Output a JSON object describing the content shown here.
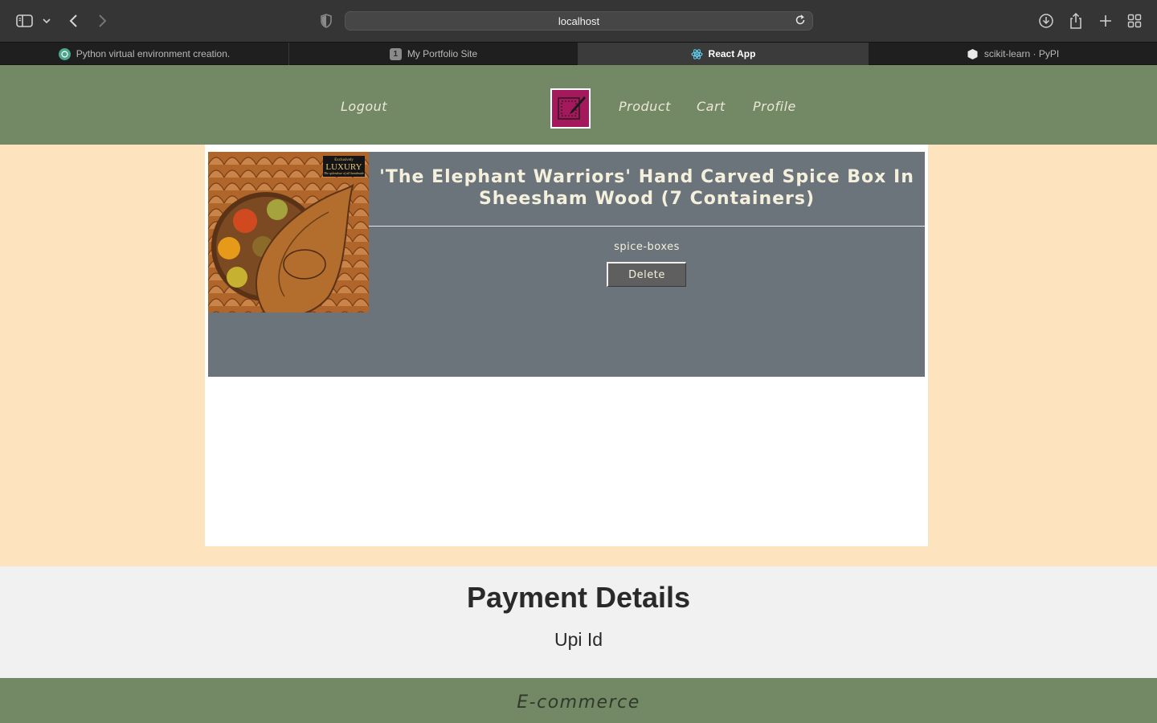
{
  "browser": {
    "url": "localhost",
    "tabs": [
      {
        "label": "Python virtual environment creation.",
        "icon": "openai-icon",
        "active": false
      },
      {
        "label": "My Portfolio Site",
        "icon": "1",
        "active": false
      },
      {
        "label": "React App",
        "icon": "react-icon",
        "active": true
      },
      {
        "label": "scikit-learn · PyPI",
        "icon": "pypi-icon",
        "active": false
      }
    ]
  },
  "header": {
    "logout": "Logout",
    "nav": [
      "Product",
      "Cart",
      "Profile"
    ],
    "logo_icon": "edit-square-icon",
    "colors": {
      "header_bg": "#738865",
      "logo_bg": "#a3195b"
    }
  },
  "cart": {
    "items": [
      {
        "title": "'The Elephant Warriors' Hand Carved Spice Box In Sheesham Wood (7 Containers)",
        "category": "spice-boxes",
        "delete_label": "Delete",
        "image_badge": "LUXURY",
        "image_badge_small": "Exclusively",
        "image_badge_script": "The splendour of all handmade"
      }
    ]
  },
  "payment": {
    "title": "Payment Details",
    "upi_label": "Upi Id"
  },
  "footer": {
    "text": "E-commerce"
  }
}
